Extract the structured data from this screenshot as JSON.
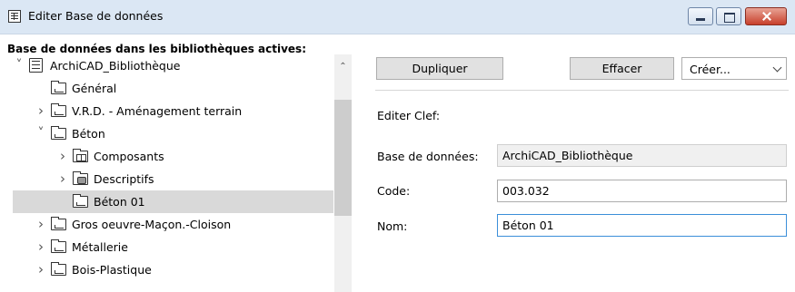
{
  "window": {
    "title": "Editer Base de données",
    "app_icon": "database-icon",
    "buttons": {
      "minimize": "minimize-icon",
      "maximize": "maximize-icon",
      "close": "close-icon"
    }
  },
  "tree": {
    "heading": "Base de données dans les bibliothèques actives:",
    "nodes": [
      {
        "label": "ArchiCAD_Bibliothèque",
        "level": 0,
        "expander": "expanded",
        "icon": "database-icon"
      },
      {
        "label": "Général",
        "level": 1,
        "expander": "none",
        "icon": "folder-icon"
      },
      {
        "label": "V.R.D. - Aménagement terrain",
        "level": 1,
        "expander": "collapsed",
        "icon": "folder-icon"
      },
      {
        "label": "Béton",
        "level": 1,
        "expander": "expanded",
        "icon": "folder-icon"
      },
      {
        "label": "Composants",
        "level": 2,
        "expander": "collapsed",
        "icon": "components-icon"
      },
      {
        "label": "Descriptifs",
        "level": 2,
        "expander": "collapsed",
        "icon": "descriptives-icon"
      },
      {
        "label": "Béton 01",
        "level": 2,
        "expander": "none",
        "icon": "folder-icon",
        "selected": true
      },
      {
        "label": "Gros oeuvre-Maçon.-Cloison",
        "level": 1,
        "expander": "collapsed",
        "icon": "folder-icon"
      },
      {
        "label": "Métallerie",
        "level": 1,
        "expander": "collapsed",
        "icon": "folder-icon"
      },
      {
        "label": "Bois-Plastique",
        "level": 1,
        "expander": "collapsed",
        "icon": "folder-icon"
      }
    ]
  },
  "toolbar": {
    "duplicate_label": "Dupliquer",
    "delete_label": "Effacer",
    "create_select_value": "Créer..."
  },
  "editor": {
    "section_title": "Editer Clef:",
    "database_label": "Base de données:",
    "database_value": "ArchiCAD_Bibliothèque",
    "code_label": "Code:",
    "code_value": "003.032",
    "name_label": "Nom:",
    "name_value": "Béton 01"
  }
}
